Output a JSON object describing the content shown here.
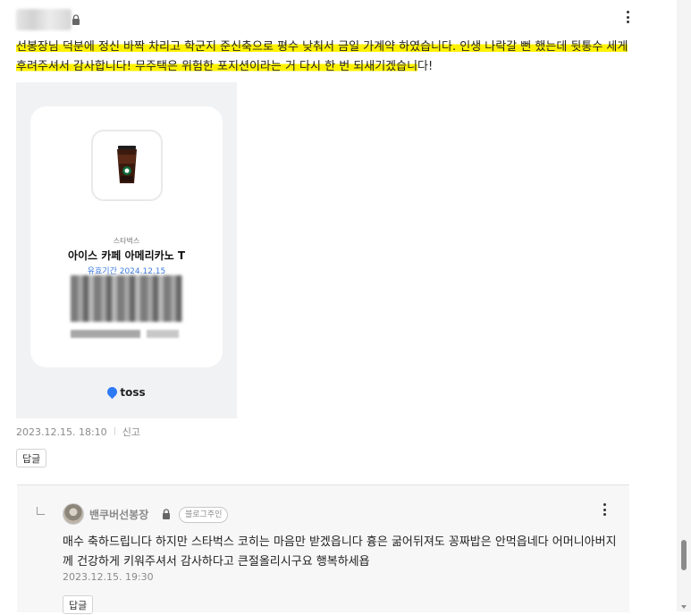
{
  "comment": {
    "text_highlighted": "선봉장님 덕분에 정신 바짝 차리고 학군지 준신축으로 평수 낮춰서 금일 가계약 하였습니다. 인생 나락갈 뻔 했는데 뒷통수 세게 후려주셔서 감사합니다! 무주택은 위험한 포지션이라는 거 다시 한 번 되새기겠습니",
    "text_plain": "다!",
    "date": "2023.12.15. 18:10",
    "report_label": "신고",
    "reply_button": "답글"
  },
  "gift_card": {
    "brand": "스타벅스",
    "product": "아이스 카페 아메리카노 T",
    "validity": "유효기간 2024.12.15",
    "app_name": "toss"
  },
  "reply": {
    "author": "밴쿠버선봉장",
    "badge": "블로그주인",
    "text": "매수 축하드립니다 하지만 스타벅스 코히는 마음만 받겠읍니다 흉은 굶어뒤져도 꽁짜밥은 안먹읍네다 어머니아버지께 건강하게 키워주셔서 감사하다고 큰절올리시구요 행복하세욥",
    "date": "2023.12.15. 19:30",
    "reply_button": "답글"
  },
  "icons": [
    "lock-icon",
    "more-options-icon",
    "coffee-cup-icon",
    "toss-logo-icon",
    "reply-arrow-icon",
    "avatar"
  ],
  "colors": {
    "highlight": "#fff200",
    "validity": "#3d7be0",
    "toss_brand": "#2e7af5"
  }
}
